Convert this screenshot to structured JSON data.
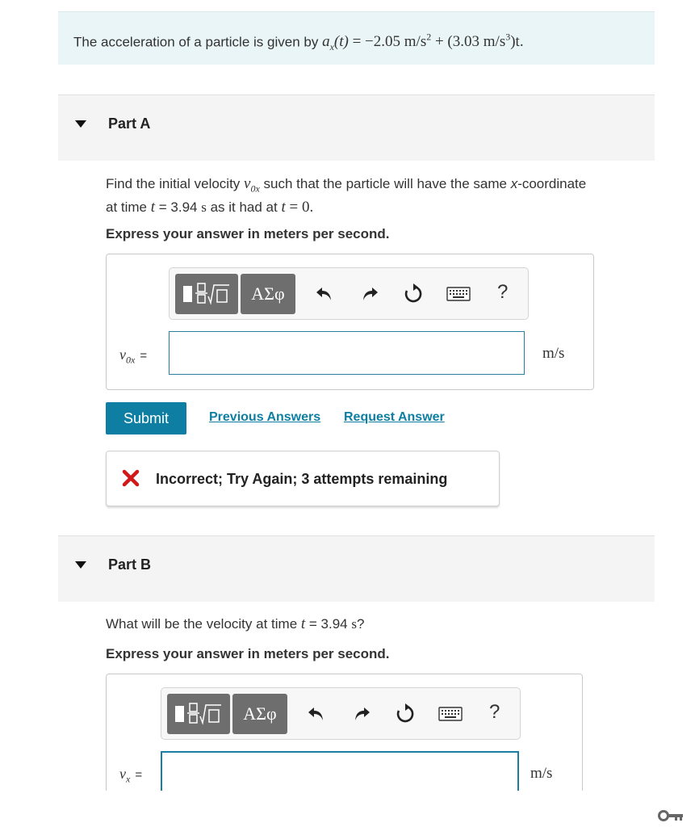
{
  "problem": {
    "prefix": "The acceleration of a particle is given by ",
    "equation": {
      "lhs_var": "a",
      "lhs_sub": "x",
      "lhs_arg": "(t)",
      "rhs_a": " = −2.05 m/s",
      "rhs_a_exp": "2",
      "rhs_b": " + (3.03 m/s",
      "rhs_b_exp": "3",
      "rhs_c": ")t."
    }
  },
  "part_a": {
    "title": "Part A",
    "question": {
      "t1": "Find the initial velocity ",
      "var": "v",
      "var_sub": "0x",
      "t2": " such that the particle will have the same ",
      "x_it": "x",
      "t3": "-coordinate",
      "t4": "at time ",
      "t_var": "t",
      "t5": " = 3.94 ",
      "s_unit": "s",
      "t6": " as it had at ",
      "t_var2": "t",
      "t7": " = 0."
    },
    "instruction": "Express your answer in meters per second.",
    "toolbar": {
      "greek_label": "ΑΣφ",
      "help_label": "?"
    },
    "input_label": {
      "var": "v",
      "sub": "0x",
      "eq": "="
    },
    "input_value": "",
    "unit": "m/s",
    "submit_label": "Submit",
    "previous_answers_label": "Previous Answers",
    "request_answer_label": "Request Answer",
    "feedback": {
      "message": "Incorrect; Try Again; 3 attempts remaining",
      "color": "#d0191b"
    }
  },
  "part_b": {
    "title": "Part B",
    "question": {
      "t1": "What will be the velocity at time ",
      "t_var": "t",
      "t2": " = 3.94 ",
      "s_unit": "s",
      "t3": "?"
    },
    "instruction": "Express your answer in meters per second.",
    "toolbar": {
      "greek_label": "ΑΣφ",
      "help_label": "?"
    },
    "input_label": {
      "var": "v",
      "sub": "x",
      "eq": "="
    },
    "input_value": "",
    "unit": "m/s"
  },
  "colors": {
    "accent": "#0e7fa3",
    "problem_bg": "#e9f5f6",
    "part_bg": "#f4f4f4",
    "toolbar_btn": "#6e6e6e"
  }
}
